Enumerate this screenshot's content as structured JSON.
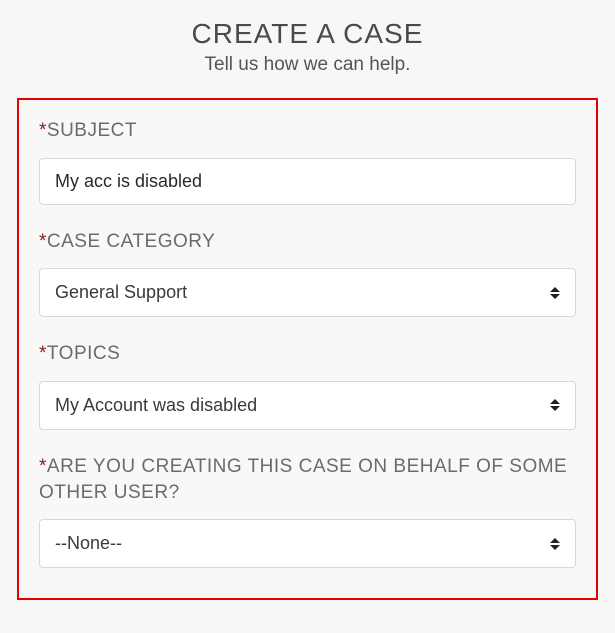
{
  "header": {
    "title": "CREATE A CASE",
    "subtitle": "Tell us how we can help."
  },
  "form": {
    "subject": {
      "label": "SUBJECT",
      "value": "My acc is disabled"
    },
    "category": {
      "label": "CASE CATEGORY",
      "value": "General Support"
    },
    "topics": {
      "label": "TOPICS",
      "value": "My Account was disabled"
    },
    "onbehalf": {
      "label": "ARE YOU CREATING THIS CASE ON BEHALF OF SOME OTHER USER?",
      "value": "--None--"
    }
  }
}
